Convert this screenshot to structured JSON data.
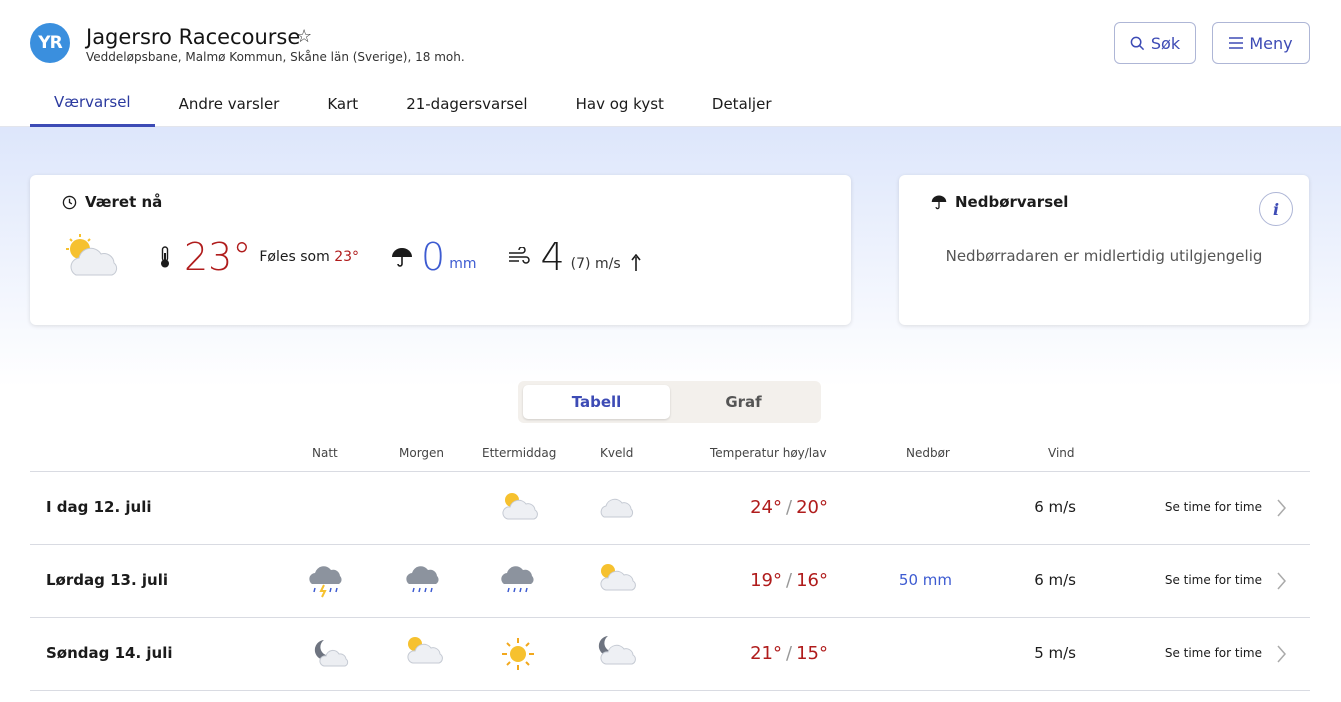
{
  "header": {
    "logo": "YR",
    "title": "Jagersro Racecourse",
    "subtitle": "Veddeløpsbane, Malmø Kommun, Skåne län (Sverige), 18 moh.",
    "search_label": "Søk",
    "menu_label": "Meny",
    "tabs": [
      "Værvarsel",
      "Andre varsler",
      "Kart",
      "21-dagersvarsel",
      "Hav og kyst",
      "Detaljer"
    ],
    "active_tab": "Værvarsel"
  },
  "now": {
    "heading": "Været nå",
    "temperature": "23°",
    "feels_label": "Føles som",
    "feels_value": "23°",
    "precip_value": "0",
    "precip_unit": "mm",
    "wind_value": "4",
    "wind_gust": "(7)",
    "wind_unit": "m/s",
    "wind_direction_icon": "arrow-up-icon",
    "weather_icon": "partly-cloudy-day-icon"
  },
  "precipitation_card": {
    "heading": "Nedbørvarsel",
    "info_label": "i",
    "message": "Nedbørradaren er midlertidig utilgjengelig"
  },
  "view_toggle": {
    "options": [
      "Tabell",
      "Graf"
    ],
    "selected": "Tabell"
  },
  "table": {
    "headers": {
      "night": "Natt",
      "morning": "Morgen",
      "afternoon": "Ettermiddag",
      "evening": "Kveld",
      "temperature": "Temperatur høy/lav",
      "precipitation": "Nedbør",
      "wind": "Vind"
    },
    "rows": [
      {
        "day": "I dag 12. juli",
        "icons": [
          "",
          "",
          "partly-cloudy-day-icon",
          "cloud-icon"
        ],
        "high": "24°",
        "low": "20°",
        "precipitation": "",
        "wind": "6 m/s",
        "link": "Se time for time"
      },
      {
        "day": "Lørdag 13. juli",
        "icons": [
          "thunderstorm-rain-icon",
          "rain-cloud-icon",
          "rain-cloud-icon",
          "partly-cloudy-day-icon"
        ],
        "high": "19°",
        "low": "16°",
        "precipitation": "50 mm",
        "wind": "6 m/s",
        "link": "Se time for time"
      },
      {
        "day": "Søndag 14. juli",
        "icons": [
          "partly-cloudy-night-icon",
          "partly-cloudy-day-icon",
          "sun-icon",
          "partly-cloudy-night-icon"
        ],
        "high": "21°",
        "low": "15°",
        "precipitation": "",
        "wind": "5 m/s",
        "link": "Se time for time"
      }
    ]
  },
  "colors": {
    "brand": "#3a8fde",
    "accent": "#3d4bb5",
    "temperature_warm": "#b01c1c",
    "precipitation": "#3d5bd1"
  }
}
